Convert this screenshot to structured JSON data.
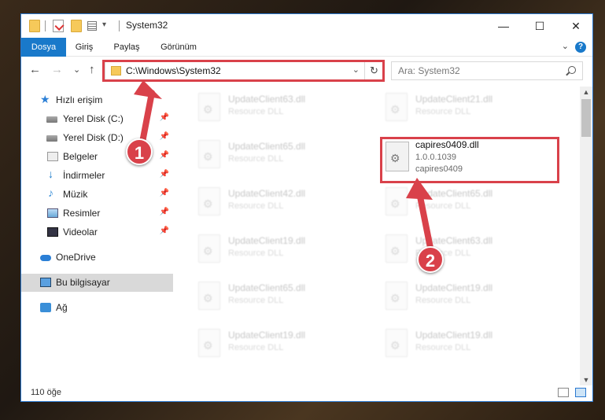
{
  "window": {
    "title": "System32",
    "controls": {
      "minimize": "—",
      "maximize": "☐",
      "close": "✕"
    }
  },
  "quick_access": {
    "dropdown": "▾"
  },
  "ribbon": {
    "tabs": [
      {
        "label": "Dosya",
        "active": true
      },
      {
        "label": "Giriş",
        "active": false
      },
      {
        "label": "Paylaş",
        "active": false
      },
      {
        "label": "Görünüm",
        "active": false
      }
    ],
    "expand": "⌄",
    "help": "?"
  },
  "navigation": {
    "back": "←",
    "forward": "→",
    "recent": "⌄",
    "up": "↑",
    "address": "C:\\Windows\\System32",
    "address_dropdown": "⌄",
    "refresh": "↻",
    "search_placeholder": "Ara: System32"
  },
  "sidebar": {
    "items": [
      {
        "label": "Hızlı erişim",
        "icon": "star-icon",
        "pinned": false
      },
      {
        "label": "Yerel Disk (C:)",
        "icon": "disk-icon",
        "pinned": true
      },
      {
        "label": "Yerel Disk (D:)",
        "icon": "disk-icon",
        "pinned": true
      },
      {
        "label": "Belgeler",
        "icon": "documents-icon",
        "pinned": true
      },
      {
        "label": "İndirmeler",
        "icon": "download-icon",
        "pinned": true
      },
      {
        "label": "Müzik",
        "icon": "music-icon",
        "pinned": true
      },
      {
        "label": "Resimler",
        "icon": "pictures-icon",
        "pinned": true
      },
      {
        "label": "Videolar",
        "icon": "videos-icon",
        "pinned": true
      },
      {
        "label": "OneDrive",
        "icon": "cloud-icon",
        "pinned": false
      },
      {
        "label": "Bu bilgisayar",
        "icon": "computer-icon",
        "pinned": false,
        "selected": true
      },
      {
        "label": "Ağ",
        "icon": "network-icon",
        "pinned": false
      }
    ],
    "pin_glyph": "📌"
  },
  "files": {
    "left_column": [
      {
        "name": "UpdateClient63.dll",
        "desc": "Resource DLL"
      },
      {
        "name": "UpdateClient65.dll",
        "desc": "Resource DLL"
      },
      {
        "name": "UpdateClient42.dll",
        "desc": "Resource DLL"
      },
      {
        "name": "UpdateClient19.dll",
        "desc": "Resource DLL"
      },
      {
        "name": "UpdateClient65.dll",
        "desc": "Resource DLL"
      },
      {
        "name": "UpdateClient19.dll",
        "desc": "Resource DLL"
      }
    ],
    "right_column": [
      {
        "name": "UpdateClient21.dll",
        "desc": "Resource DLL"
      },
      {
        "name": "capires0409.dll",
        "version": "1.0.0.1039",
        "desc": "capires0409",
        "highlighted": true
      },
      {
        "name": "UpdateClient65.dll",
        "desc": "Resource DLL"
      },
      {
        "name": "UpdateClient63.dll",
        "desc": "Resource DLL"
      },
      {
        "name": "UpdateClient19.dll",
        "desc": "Resource DLL"
      },
      {
        "name": "UpdateClient19.dll",
        "desc": "Resource DLL"
      }
    ]
  },
  "status": {
    "count": "110 öğe"
  },
  "annotations": {
    "badge1": "1",
    "badge2": "2",
    "color": "#d9414a"
  }
}
